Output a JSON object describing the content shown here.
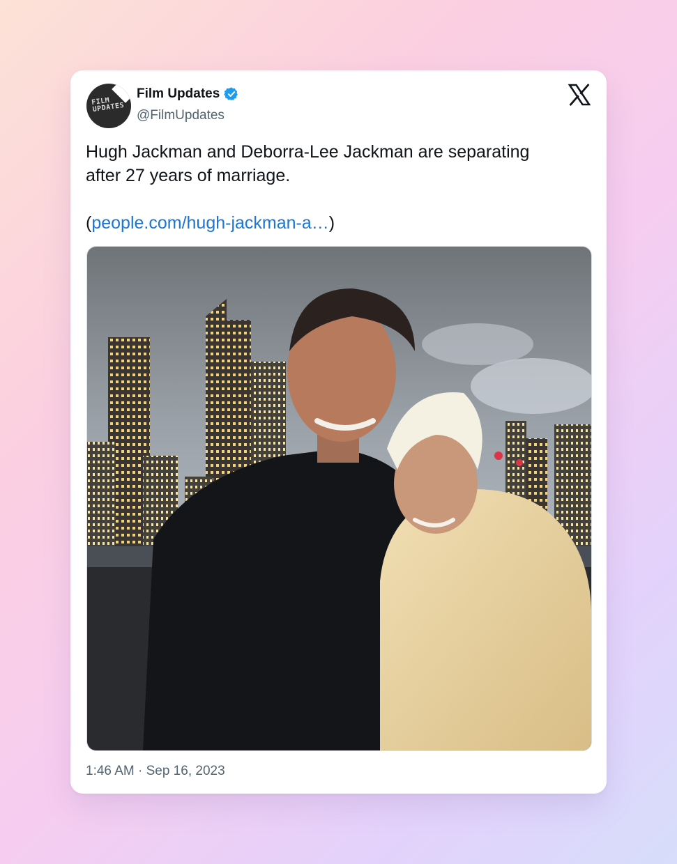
{
  "tweet": {
    "author_name": "Film Updates",
    "handle": "@FilmUpdates",
    "avatar_text_line1": "FILM",
    "avatar_text_line2": "UPDATES",
    "body": "Hugh Jackman and Deborra-Lee Jackman are separating\nafter 27 years of marriage.",
    "link_open": "(",
    "link_text": "people.com/hugh-jackman-a…",
    "link_close": ")",
    "timestamp": "1:46 AM · Sep 16, 2023",
    "verified_icon": "verified-badge-icon",
    "platform_icon": "x-logo-icon"
  },
  "colors": {
    "verified": "#1d9bf0",
    "link": "#1d76d2",
    "secondary_text": "#536471"
  }
}
